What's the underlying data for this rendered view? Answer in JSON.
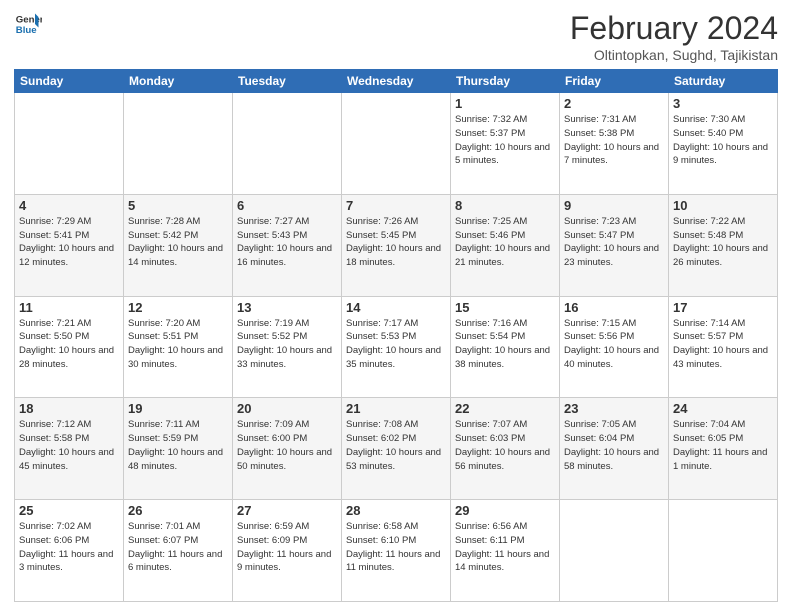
{
  "header": {
    "logo_line1": "General",
    "logo_line2": "Blue",
    "title": "February 2024",
    "subtitle": "Oltintopkan, Sughd, Tajikistan"
  },
  "weekdays": [
    "Sunday",
    "Monday",
    "Tuesday",
    "Wednesday",
    "Thursday",
    "Friday",
    "Saturday"
  ],
  "weeks": [
    {
      "days": [
        {
          "num": "",
          "info": ""
        },
        {
          "num": "",
          "info": ""
        },
        {
          "num": "",
          "info": ""
        },
        {
          "num": "",
          "info": ""
        },
        {
          "num": "1",
          "info": "Sunrise: 7:32 AM\nSunset: 5:37 PM\nDaylight: 10 hours\nand 5 minutes."
        },
        {
          "num": "2",
          "info": "Sunrise: 7:31 AM\nSunset: 5:38 PM\nDaylight: 10 hours\nand 7 minutes."
        },
        {
          "num": "3",
          "info": "Sunrise: 7:30 AM\nSunset: 5:40 PM\nDaylight: 10 hours\nand 9 minutes."
        }
      ]
    },
    {
      "days": [
        {
          "num": "4",
          "info": "Sunrise: 7:29 AM\nSunset: 5:41 PM\nDaylight: 10 hours\nand 12 minutes."
        },
        {
          "num": "5",
          "info": "Sunrise: 7:28 AM\nSunset: 5:42 PM\nDaylight: 10 hours\nand 14 minutes."
        },
        {
          "num": "6",
          "info": "Sunrise: 7:27 AM\nSunset: 5:43 PM\nDaylight: 10 hours\nand 16 minutes."
        },
        {
          "num": "7",
          "info": "Sunrise: 7:26 AM\nSunset: 5:45 PM\nDaylight: 10 hours\nand 18 minutes."
        },
        {
          "num": "8",
          "info": "Sunrise: 7:25 AM\nSunset: 5:46 PM\nDaylight: 10 hours\nand 21 minutes."
        },
        {
          "num": "9",
          "info": "Sunrise: 7:23 AM\nSunset: 5:47 PM\nDaylight: 10 hours\nand 23 minutes."
        },
        {
          "num": "10",
          "info": "Sunrise: 7:22 AM\nSunset: 5:48 PM\nDaylight: 10 hours\nand 26 minutes."
        }
      ]
    },
    {
      "days": [
        {
          "num": "11",
          "info": "Sunrise: 7:21 AM\nSunset: 5:50 PM\nDaylight: 10 hours\nand 28 minutes."
        },
        {
          "num": "12",
          "info": "Sunrise: 7:20 AM\nSunset: 5:51 PM\nDaylight: 10 hours\nand 30 minutes."
        },
        {
          "num": "13",
          "info": "Sunrise: 7:19 AM\nSunset: 5:52 PM\nDaylight: 10 hours\nand 33 minutes."
        },
        {
          "num": "14",
          "info": "Sunrise: 7:17 AM\nSunset: 5:53 PM\nDaylight: 10 hours\nand 35 minutes."
        },
        {
          "num": "15",
          "info": "Sunrise: 7:16 AM\nSunset: 5:54 PM\nDaylight: 10 hours\nand 38 minutes."
        },
        {
          "num": "16",
          "info": "Sunrise: 7:15 AM\nSunset: 5:56 PM\nDaylight: 10 hours\nand 40 minutes."
        },
        {
          "num": "17",
          "info": "Sunrise: 7:14 AM\nSunset: 5:57 PM\nDaylight: 10 hours\nand 43 minutes."
        }
      ]
    },
    {
      "days": [
        {
          "num": "18",
          "info": "Sunrise: 7:12 AM\nSunset: 5:58 PM\nDaylight: 10 hours\nand 45 minutes."
        },
        {
          "num": "19",
          "info": "Sunrise: 7:11 AM\nSunset: 5:59 PM\nDaylight: 10 hours\nand 48 minutes."
        },
        {
          "num": "20",
          "info": "Sunrise: 7:09 AM\nSunset: 6:00 PM\nDaylight: 10 hours\nand 50 minutes."
        },
        {
          "num": "21",
          "info": "Sunrise: 7:08 AM\nSunset: 6:02 PM\nDaylight: 10 hours\nand 53 minutes."
        },
        {
          "num": "22",
          "info": "Sunrise: 7:07 AM\nSunset: 6:03 PM\nDaylight: 10 hours\nand 56 minutes."
        },
        {
          "num": "23",
          "info": "Sunrise: 7:05 AM\nSunset: 6:04 PM\nDaylight: 10 hours\nand 58 minutes."
        },
        {
          "num": "24",
          "info": "Sunrise: 7:04 AM\nSunset: 6:05 PM\nDaylight: 11 hours\nand 1 minute."
        }
      ]
    },
    {
      "days": [
        {
          "num": "25",
          "info": "Sunrise: 7:02 AM\nSunset: 6:06 PM\nDaylight: 11 hours\nand 3 minutes."
        },
        {
          "num": "26",
          "info": "Sunrise: 7:01 AM\nSunset: 6:07 PM\nDaylight: 11 hours\nand 6 minutes."
        },
        {
          "num": "27",
          "info": "Sunrise: 6:59 AM\nSunset: 6:09 PM\nDaylight: 11 hours\nand 9 minutes."
        },
        {
          "num": "28",
          "info": "Sunrise: 6:58 AM\nSunset: 6:10 PM\nDaylight: 11 hours\nand 11 minutes."
        },
        {
          "num": "29",
          "info": "Sunrise: 6:56 AM\nSunset: 6:11 PM\nDaylight: 11 hours\nand 14 minutes."
        },
        {
          "num": "",
          "info": ""
        },
        {
          "num": "",
          "info": ""
        }
      ]
    }
  ]
}
